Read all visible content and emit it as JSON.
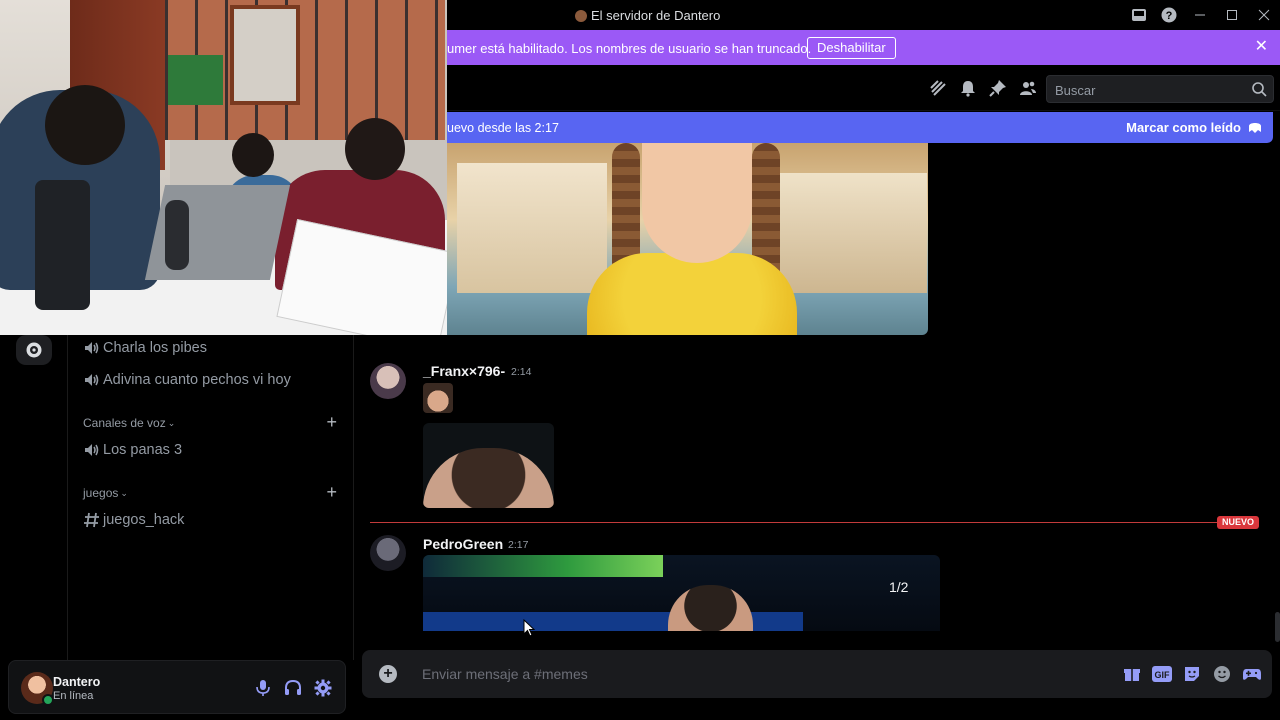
{
  "window": {
    "title": "El servidor de Dantero"
  },
  "banner": {
    "text": "umer está habilitado. Los nombres de usuario se han truncado.",
    "button_label": "Deshabilitar"
  },
  "header": {
    "search_placeholder": "Buscar",
    "icons": [
      "threads-icon",
      "bell-icon",
      "pin-icon",
      "members-icon",
      "search-icon"
    ]
  },
  "new_messages_bar": {
    "text": "uevo desde las 2:17",
    "mark_read_label": "Marcar como leído"
  },
  "channels": {
    "text_channels": [
      {
        "name": "Charla los pibes",
        "type": "voice"
      },
      {
        "name": "Adivina cuanto pechos vi hoy",
        "type": "voice"
      }
    ],
    "categories": [
      {
        "label": "Canales de voz",
        "channels": [
          {
            "name": "Los panas 3",
            "type": "voice"
          }
        ]
      },
      {
        "label": "juegos",
        "channels": [
          {
            "name": "juegos_hack",
            "type": "text"
          }
        ]
      }
    ]
  },
  "user": {
    "name": "Dantero",
    "status": "En línea"
  },
  "messages": [
    {
      "author": "_Franx×796-",
      "time": "2:14"
    },
    {
      "author": "PedroGreen",
      "time": "2:17",
      "attachment_counter": "1/2"
    }
  ],
  "divider": {
    "label": "NUEVO"
  },
  "composer": {
    "placeholder": "Enviar mensaje a #memes",
    "gif_label": "GIF"
  },
  "colors": {
    "banner": "#9b59f6",
    "blurple": "#5865f2",
    "new_red": "#da373c",
    "online_green": "#23a55a"
  }
}
